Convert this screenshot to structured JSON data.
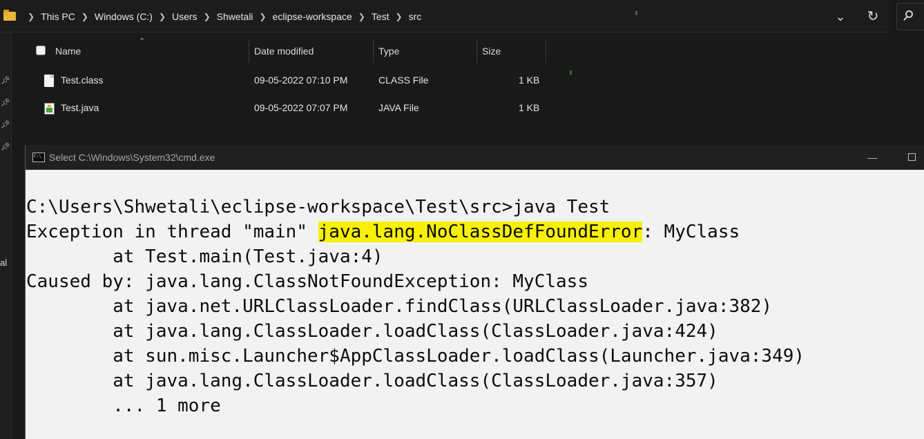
{
  "explorer": {
    "breadcrumbs": [
      "This PC",
      "Windows (C:)",
      "Users",
      "Shwetali",
      "eclipse-workspace",
      "Test",
      "src"
    ],
    "icons": {
      "folder": "folder-icon",
      "chevron": "chevron-down-icon",
      "refresh": "refresh-icon",
      "search": "search-icon"
    },
    "columns": {
      "name": "Name",
      "date": "Date modified",
      "type": "Type",
      "size": "Size"
    },
    "files": [
      {
        "name": "Test.class",
        "date": "09-05-2022 07:10 PM",
        "type": "CLASS File",
        "size": "1 KB"
      },
      {
        "name": "Test.java",
        "date": "09-05-2022 07:07 PM",
        "type": "JAVA File",
        "size": "1 KB"
      }
    ],
    "nav_partial_label": "al"
  },
  "cmd": {
    "title": "Select C:\\Windows\\System32\\cmd.exe",
    "lines": {
      "l1": "C:\\Users\\Shwetali\\eclipse-workspace\\Test\\src>java Test",
      "l2_pre": "Exception in thread \"main\" ",
      "l2_hl": "java.lang.NoClassDefFoundError",
      "l2_post": ": MyClass",
      "l3": "        at Test.main(Test.java:4)",
      "l4": "Caused by: java.lang.ClassNotFoundException: MyClass",
      "l5": "        at java.net.URLClassLoader.findClass(URLClassLoader.java:382)",
      "l6": "        at java.lang.ClassLoader.loadClass(ClassLoader.java:424)",
      "l7": "        at sun.misc.Launcher$AppClassLoader.loadClass(Launcher.java:349)",
      "l8": "        at java.lang.ClassLoader.loadClass(ClassLoader.java:357)",
      "l9": "        ... 1 more"
    },
    "highlight_color": "#f7f000"
  }
}
